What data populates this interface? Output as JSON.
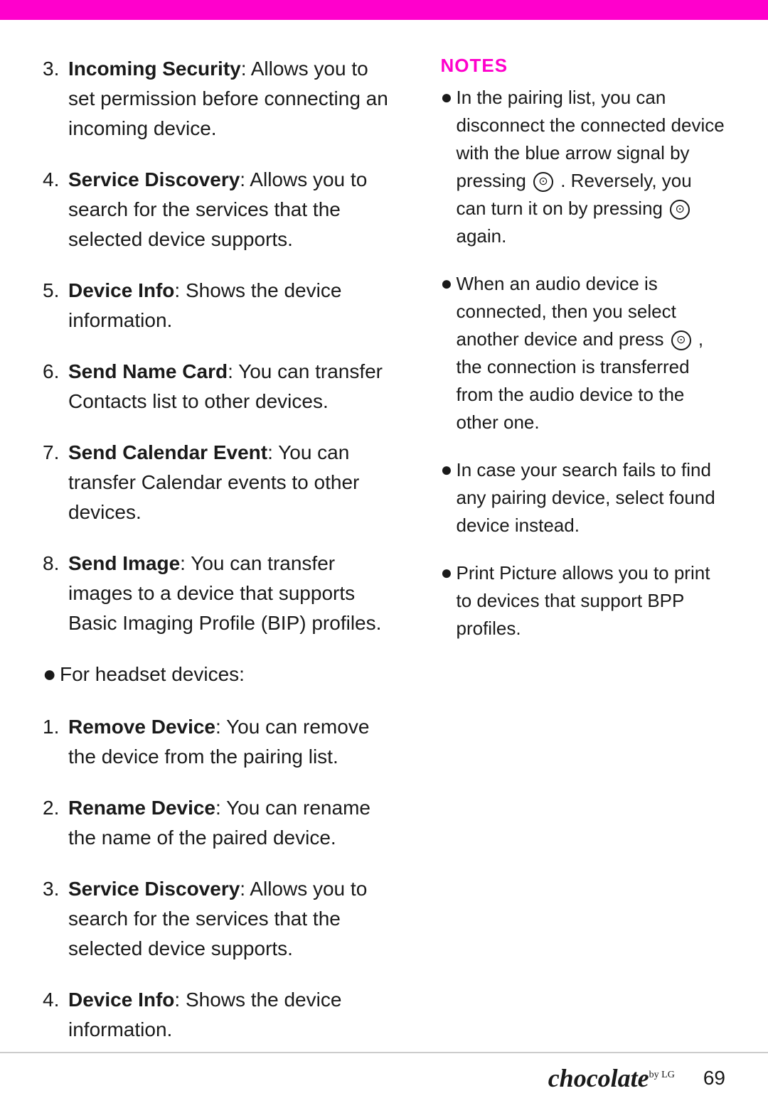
{
  "topbar": {
    "color": "#ff00cc"
  },
  "left_column": {
    "items": [
      {
        "number": "3.",
        "bold": "Incoming Security",
        "text": ": Allows you to set permission before connecting an incoming device."
      },
      {
        "number": "4.",
        "bold": "Service Discovery",
        "text": ": Allows you to search for the services that the selected device supports."
      },
      {
        "number": "5.",
        "bold": "Device Info",
        "text": ": Shows the device information."
      },
      {
        "number": "6.",
        "bold": "Send Name Card",
        "text": ": You can transfer Contacts list to other devices."
      },
      {
        "number": "7.",
        "bold": "Send Calendar Event",
        "text": ": You can transfer Calendar events to other devices."
      },
      {
        "number": "8.",
        "bold": "Send Image",
        "text": ": You can transfer images to a device that supports Basic Imaging Profile (BIP) profiles."
      }
    ],
    "bullet_items": [
      {
        "text": "For headset devices:"
      }
    ],
    "headset_items": [
      {
        "number": "1.",
        "bold": "Remove Device",
        "text": ": You can remove the device from the pairing list."
      },
      {
        "number": "2.",
        "bold": "Rename Device",
        "text": ": You can rename the name of the paired device."
      },
      {
        "number": "3.",
        "bold": "Service Discovery",
        "text": ": Allows you to search for the services that the selected device supports."
      },
      {
        "number": "4.",
        "bold": "Device Info",
        "text": ": Shows the device information."
      }
    ]
  },
  "right_column": {
    "notes_label": "NOTES",
    "notes": [
      {
        "text": "In the pairing list, you can disconnect the connected device with the blue arrow signal by pressing",
        "has_circle1": true,
        "circle1_content": "⊙",
        "text2": ". Reversely, you can turn it on by pressing",
        "has_circle2": true,
        "circle2_content": "⊙",
        "text3": "again."
      },
      {
        "text": "When an audio device is connected, then you select another device and press",
        "has_circle": true,
        "circle_content": "⊙",
        "text2": ", the connection is transferred from the audio device to the other one."
      },
      {
        "text": "In case your search fails to find any pairing device, select found device instead."
      },
      {
        "text": "Print Picture allows you to print to devices that support BPP profiles."
      }
    ]
  },
  "footer": {
    "brand": "chocolate",
    "brand_suffix": "by LG",
    "page_number": "69"
  }
}
